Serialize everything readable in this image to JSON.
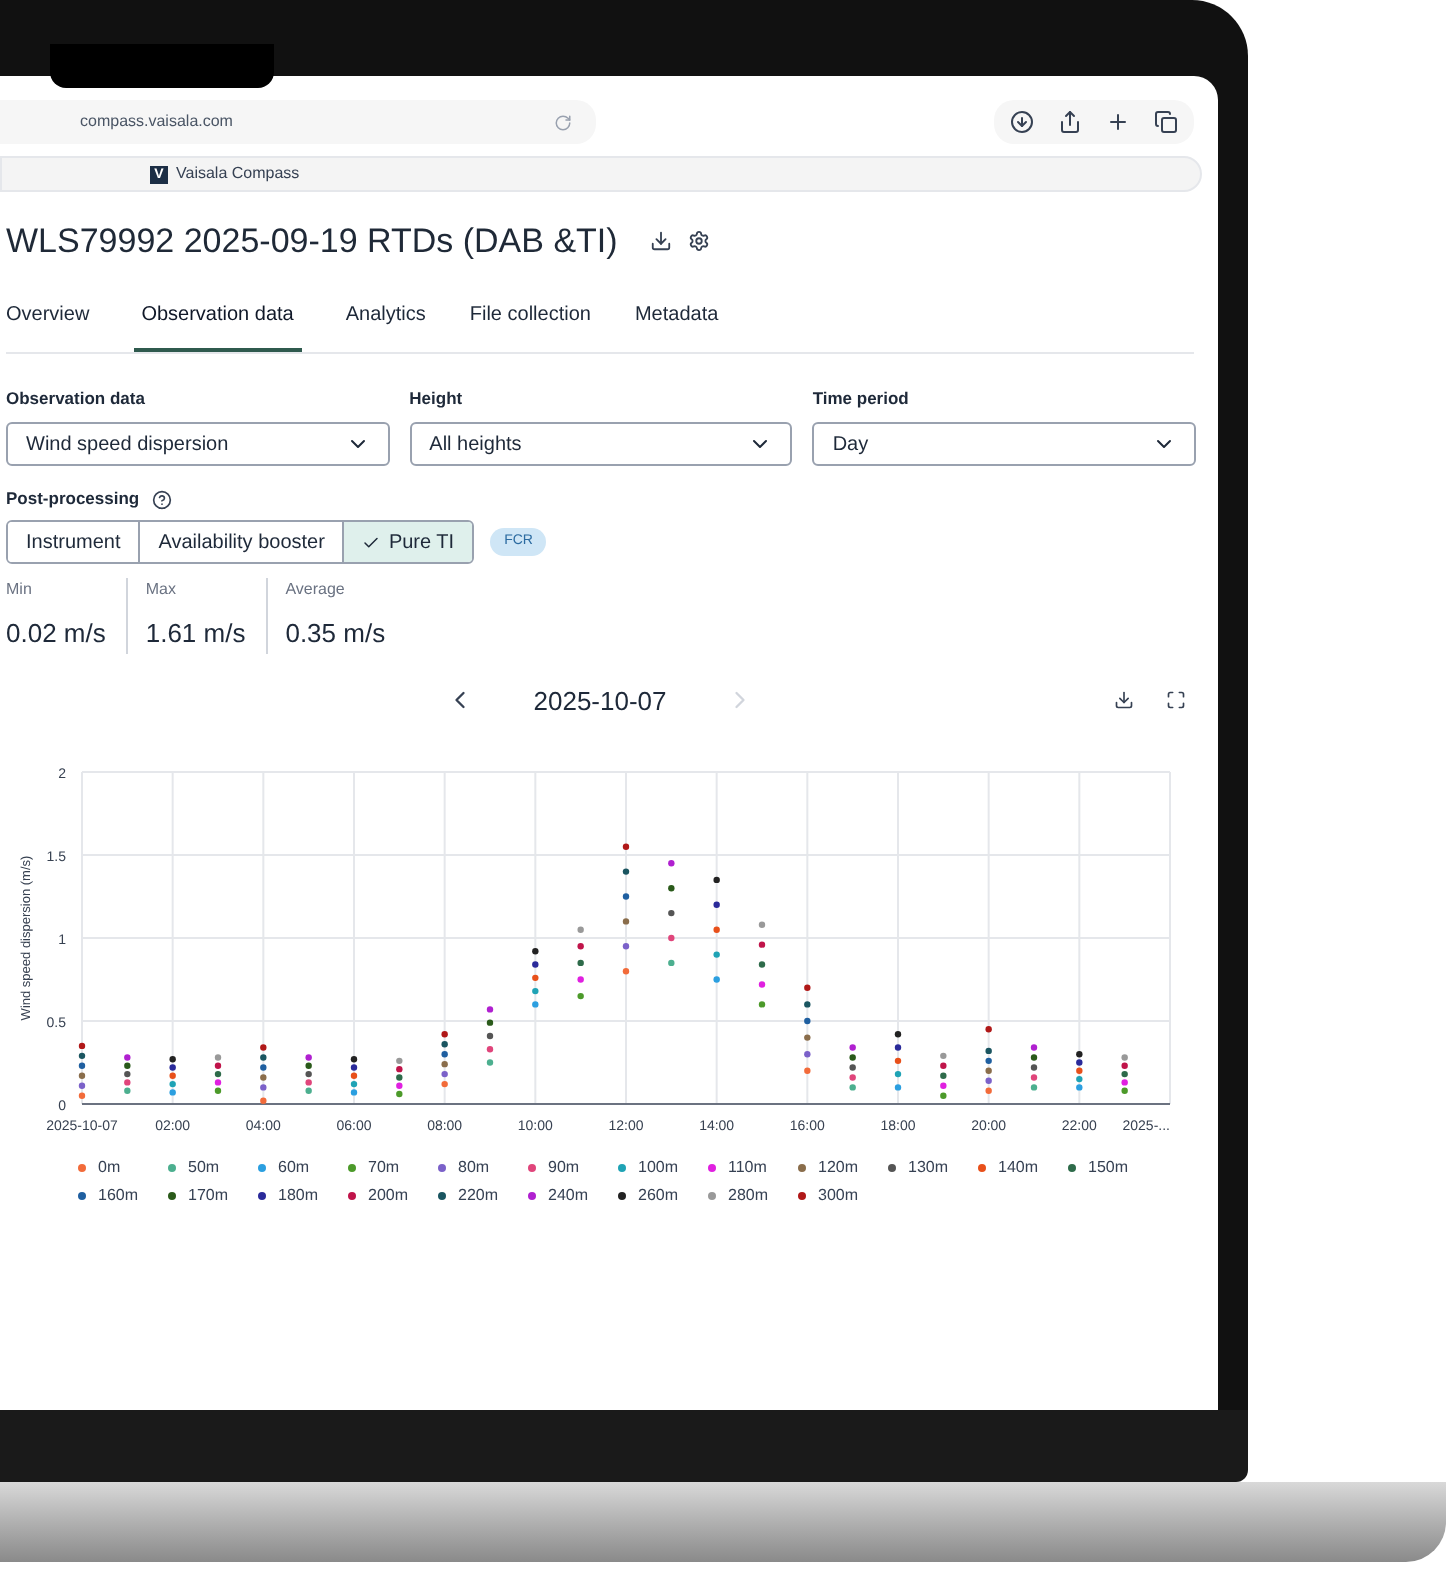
{
  "browser": {
    "url": "compass.vaisala.com",
    "tab": {
      "logo": "V",
      "title": "Vaisala Compass"
    }
  },
  "page": {
    "title": "WLS79992 2025-09-19 RTDs (DAB &TI)",
    "tabs": [
      {
        "label": "Overview",
        "selected": false
      },
      {
        "label": "Observation data",
        "selected": true
      },
      {
        "label": "Analytics",
        "selected": false
      },
      {
        "label": "File collection",
        "selected": false
      },
      {
        "label": "Metadata",
        "selected": false
      }
    ],
    "filters": [
      {
        "label": "Observation data",
        "value": "Wind speed dispersion"
      },
      {
        "label": "Height",
        "value": "All heights"
      },
      {
        "label": "Time period",
        "value": "Day"
      }
    ],
    "post_processing": {
      "label": "Post-processing",
      "options": [
        {
          "label": "Instrument",
          "selected": false
        },
        {
          "label": "Availability booster",
          "selected": false
        },
        {
          "label": "Pure TI",
          "selected": true
        }
      ],
      "badge": "FCR"
    },
    "stats": [
      {
        "label": "Min",
        "value": "0.02 m/s"
      },
      {
        "label": "Max",
        "value": "1.61 m/s"
      },
      {
        "label": "Average",
        "value": "0.35 m/s"
      }
    ],
    "date_nav": {
      "date": "2025-10-07",
      "prev_disabled": false,
      "next_disabled": true
    },
    "chart": {
      "chart_data": {
        "type": "scatter",
        "ylabel": "Wind speed dispersion (m/s)",
        "grid": true,
        "legend": "bottom",
        "x": [
          0,
          1,
          2,
          3,
          4,
          5,
          6,
          7,
          8,
          9,
          10,
          11,
          12,
          13,
          14,
          15,
          16,
          17,
          18,
          19,
          20,
          21,
          22,
          23
        ],
        "xlim": [
          0,
          24
        ],
        "ylim": [
          0,
          2
        ],
        "xticks": [
          {
            "value": 0,
            "label": "2025-10-07"
          },
          {
            "value": 2,
            "label": "02:00"
          },
          {
            "value": 4,
            "label": "04:00"
          },
          {
            "value": 6,
            "label": "06:00"
          },
          {
            "value": 8,
            "label": "08:00"
          },
          {
            "value": 10,
            "label": "10:00"
          },
          {
            "value": 12,
            "label": "12:00"
          },
          {
            "value": 14,
            "label": "14:00"
          },
          {
            "value": 16,
            "label": "16:00"
          },
          {
            "value": 18,
            "label": "18:00"
          },
          {
            "value": 20,
            "label": "20:00"
          },
          {
            "value": 22,
            "label": "22:00"
          },
          {
            "value": 24,
            "label": "2025-..."
          }
        ],
        "yticks": [
          0,
          0.5,
          1,
          1.5,
          2
        ],
        "series": [
          {
            "name": "0m",
            "color": "#f26b3a",
            "values": [
              0.05,
              null,
              null,
              null,
              0.02,
              null,
              null,
              null,
              0.12,
              null,
              null,
              null,
              0.8,
              null,
              null,
              null,
              0.2,
              null,
              null,
              null,
              0.08,
              null,
              null,
              null
            ]
          },
          {
            "name": "50m",
            "color": "#4caf8f",
            "values": [
              null,
              0.08,
              null,
              null,
              null,
              0.08,
              null,
              null,
              null,
              0.25,
              null,
              null,
              null,
              0.85,
              null,
              null,
              null,
              0.1,
              null,
              null,
              null,
              0.1,
              null,
              null
            ]
          },
          {
            "name": "60m",
            "color": "#2b9fe0",
            "values": [
              null,
              null,
              0.07,
              null,
              null,
              null,
              0.07,
              null,
              null,
              null,
              0.6,
              null,
              null,
              null,
              0.75,
              null,
              null,
              null,
              0.1,
              null,
              null,
              null,
              0.1,
              null
            ]
          },
          {
            "name": "70m",
            "color": "#4c9a2a",
            "values": [
              null,
              null,
              null,
              0.08,
              null,
              null,
              null,
              0.06,
              null,
              null,
              null,
              0.65,
              null,
              null,
              null,
              0.6,
              null,
              null,
              null,
              0.05,
              null,
              null,
              null,
              0.08
            ]
          },
          {
            "name": "80m",
            "color": "#7b61c9",
            "values": [
              0.11,
              null,
              null,
              null,
              0.1,
              null,
              null,
              null,
              0.18,
              null,
              null,
              null,
              0.95,
              null,
              null,
              null,
              0.3,
              null,
              null,
              null,
              0.14,
              null,
              null,
              null
            ]
          },
          {
            "name": "90m",
            "color": "#e0457b",
            "values": [
              null,
              0.13,
              null,
              null,
              null,
              0.13,
              null,
              null,
              null,
              0.33,
              null,
              null,
              null,
              1.0,
              null,
              null,
              null,
              0.16,
              null,
              null,
              null,
              0.16,
              null,
              null
            ]
          },
          {
            "name": "100m",
            "color": "#1fa3b5",
            "values": [
              null,
              null,
              0.12,
              null,
              null,
              null,
              0.12,
              null,
              null,
              null,
              0.68,
              null,
              null,
              null,
              0.9,
              null,
              null,
              null,
              0.18,
              null,
              null,
              null,
              0.15,
              null
            ]
          },
          {
            "name": "110m",
            "color": "#e020e0",
            "values": [
              null,
              null,
              null,
              0.13,
              null,
              null,
              null,
              0.11,
              null,
              null,
              null,
              0.75,
              null,
              null,
              null,
              0.72,
              null,
              null,
              null,
              0.11,
              null,
              null,
              null,
              0.13
            ]
          },
          {
            "name": "120m",
            "color": "#8a6d4b",
            "values": [
              0.17,
              null,
              null,
              null,
              0.16,
              null,
              null,
              null,
              0.24,
              null,
              null,
              null,
              1.1,
              null,
              null,
              null,
              0.4,
              null,
              null,
              null,
              0.2,
              null,
              null,
              null
            ]
          },
          {
            "name": "130m",
            "color": "#555555",
            "values": [
              null,
              0.18,
              null,
              null,
              null,
              0.18,
              null,
              null,
              null,
              0.41,
              null,
              null,
              null,
              1.15,
              null,
              null,
              null,
              0.22,
              null,
              null,
              null,
              0.22,
              null,
              null
            ]
          },
          {
            "name": "140m",
            "color": "#e8501a",
            "values": [
              null,
              null,
              0.17,
              null,
              null,
              null,
              0.17,
              null,
              null,
              null,
              0.76,
              null,
              null,
              null,
              1.05,
              null,
              null,
              null,
              0.26,
              null,
              null,
              null,
              0.2,
              null
            ]
          },
          {
            "name": "150m",
            "color": "#2e6b4a",
            "values": [
              null,
              null,
              null,
              0.18,
              null,
              null,
              null,
              0.16,
              null,
              null,
              null,
              0.85,
              null,
              null,
              null,
              0.84,
              null,
              null,
              null,
              0.17,
              null,
              null,
              null,
              0.18
            ]
          },
          {
            "name": "160m",
            "color": "#1f5fa0",
            "values": [
              0.23,
              null,
              null,
              null,
              0.22,
              null,
              null,
              null,
              0.3,
              null,
              null,
              null,
              1.25,
              null,
              null,
              null,
              0.5,
              null,
              null,
              null,
              0.26,
              null,
              null,
              null
            ]
          },
          {
            "name": "170m",
            "color": "#2a5a1a",
            "values": [
              null,
              0.23,
              null,
              null,
              null,
              0.23,
              null,
              null,
              null,
              0.49,
              null,
              null,
              null,
              1.3,
              null,
              null,
              null,
              0.28,
              null,
              null,
              null,
              0.28,
              null,
              null
            ]
          },
          {
            "name": "180m",
            "color": "#2a2a9a",
            "values": [
              null,
              null,
              0.22,
              null,
              null,
              null,
              0.22,
              null,
              null,
              null,
              0.84,
              null,
              null,
              null,
              1.2,
              null,
              null,
              null,
              0.34,
              null,
              null,
              null,
              0.25,
              null
            ]
          },
          {
            "name": "200m",
            "color": "#c0144a",
            "values": [
              null,
              null,
              null,
              0.23,
              null,
              null,
              null,
              0.21,
              null,
              null,
              null,
              0.95,
              null,
              null,
              null,
              0.96,
              null,
              null,
              null,
              0.23,
              null,
              null,
              null,
              0.23
            ]
          },
          {
            "name": "220m",
            "color": "#1a5560",
            "values": [
              0.29,
              null,
              null,
              null,
              0.28,
              null,
              null,
              null,
              0.36,
              null,
              null,
              null,
              1.4,
              null,
              null,
              null,
              0.6,
              null,
              null,
              null,
              0.32,
              null,
              null,
              null
            ]
          },
          {
            "name": "240m",
            "color": "#b020d0",
            "values": [
              null,
              0.28,
              null,
              null,
              null,
              0.28,
              null,
              null,
              null,
              0.57,
              null,
              null,
              null,
              1.45,
              null,
              null,
              null,
              0.34,
              null,
              null,
              null,
              0.34,
              null,
              null
            ]
          },
          {
            "name": "260m",
            "color": "#222222",
            "values": [
              null,
              null,
              0.27,
              null,
              null,
              null,
              0.27,
              null,
              null,
              null,
              0.92,
              null,
              null,
              null,
              1.35,
              null,
              null,
              null,
              0.42,
              null,
              null,
              null,
              0.3,
              null
            ]
          },
          {
            "name": "280m",
            "color": "#999999",
            "values": [
              null,
              null,
              null,
              0.28,
              null,
              null,
              null,
              0.26,
              null,
              null,
              null,
              1.05,
              null,
              null,
              null,
              1.08,
              null,
              null,
              null,
              0.29,
              null,
              null,
              null,
              0.28
            ]
          },
          {
            "name": "300m",
            "color": "#b01818",
            "values": [
              0.35,
              null,
              null,
              null,
              0.34,
              null,
              null,
              null,
              0.42,
              null,
              null,
              null,
              1.55,
              null,
              null,
              null,
              0.7,
              null,
              null,
              null,
              0.45,
              null,
              null,
              null
            ]
          }
        ]
      }
    }
  }
}
